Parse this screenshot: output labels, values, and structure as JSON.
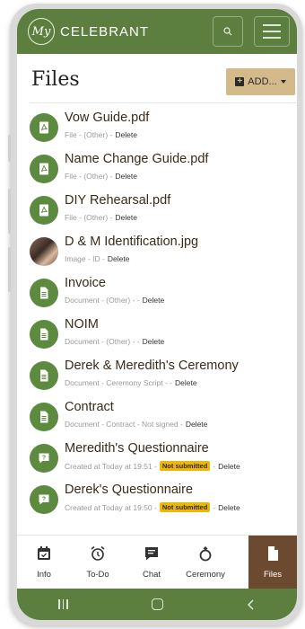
{
  "header": {
    "logo_text": "My",
    "brand": "CELEBRANT"
  },
  "page": {
    "title": "Files",
    "add_label": "ADD...",
    "add_plus": "+"
  },
  "files": [
    {
      "name": "Vow Guide.pdf",
      "meta": "File - (Other) -",
      "delete": "Delete",
      "icon": "pdf-icon"
    },
    {
      "name": "Name Change Guide.pdf",
      "meta": "File - (Other) -",
      "delete": "Delete",
      "icon": "pdf-icon"
    },
    {
      "name": "DIY Rehearsal.pdf",
      "meta": "File - (Other) -",
      "delete": "Delete",
      "icon": "pdf-icon"
    },
    {
      "name": "D & M Identification.jpg",
      "meta": "Image - ID -",
      "delete": "Delete",
      "icon": "photo-avatar"
    },
    {
      "name": "Invoice",
      "meta": "Document - (Other) - -",
      "delete": "Delete",
      "icon": "document-icon"
    },
    {
      "name": "NOIM",
      "meta": "Document - (Other) - -",
      "delete": "Delete",
      "icon": "document-icon"
    },
    {
      "name": "Derek & Meredith's Ceremony",
      "meta": "Document - Ceremony Script - -",
      "delete": "Delete",
      "icon": "document-icon"
    },
    {
      "name": "Contract",
      "meta": "Document - Contract - Not signed -",
      "delete": "Delete",
      "icon": "document-icon"
    },
    {
      "name": "Meredith's Questionnaire",
      "meta": "Created at Today at 19:51 -",
      "badge": "Not submitted",
      "after": "-",
      "delete": "Delete",
      "icon": "questionnaire-icon"
    },
    {
      "name": "Derek's Questionnaire",
      "meta": "Created at Today at 19:50 -",
      "badge": "Not submitted",
      "after": "-",
      "delete": "Delete",
      "icon": "questionnaire-icon"
    }
  ],
  "tabs": [
    {
      "label": "Info",
      "icon": "calendar-icon"
    },
    {
      "label": "To-Do",
      "icon": "alarm-clock-icon"
    },
    {
      "label": "Chat",
      "icon": "chat-icon"
    },
    {
      "label": "Ceremony",
      "icon": "ring-icon"
    },
    {
      "label": "Files",
      "icon": "file-icon",
      "active": true
    }
  ],
  "colors": {
    "brand_green": "#5c7f3f",
    "icon_green": "#5c8a3f",
    "add_button": "#d4b98a",
    "active_tab": "#6b4a2f",
    "badge": "#f1b700"
  }
}
